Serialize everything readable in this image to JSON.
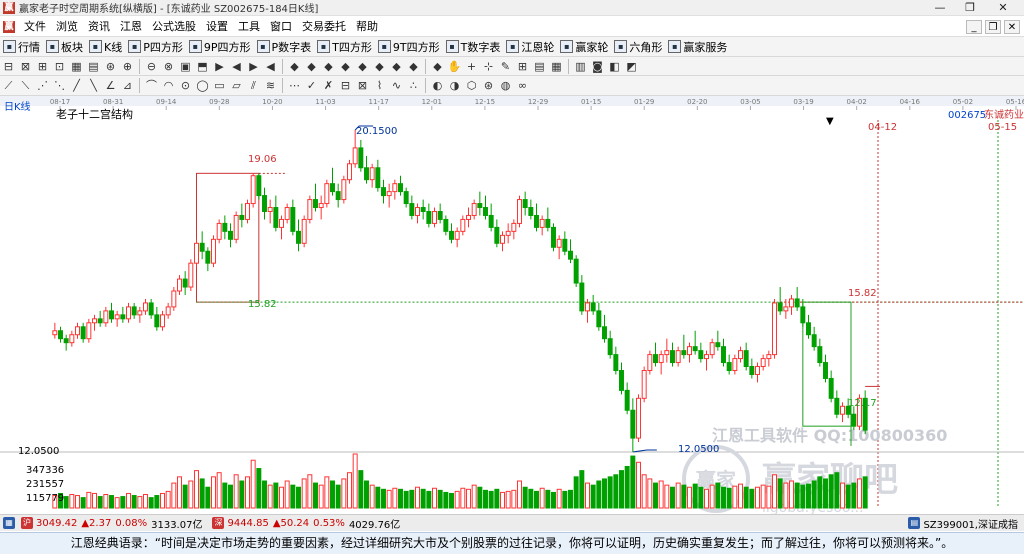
{
  "window": {
    "title": "赢家老子时空周期系统[纵横版] - [东诚药业  SZ002675-184日K线]",
    "min_glyph": "—",
    "restore_glyph": "❐",
    "close_glyph": "✕"
  },
  "menu": {
    "items": [
      "文件",
      "浏览",
      "资讯",
      "江恩",
      "公式选股",
      "设置",
      "工具",
      "窗口",
      "交易委托",
      "帮助"
    ],
    "mdi_min": "_",
    "mdi_restore": "❐",
    "mdi_close": "✕"
  },
  "toolbar1": {
    "buttons": [
      "行情",
      "板块",
      "K线",
      "P四方形",
      "9P四方形",
      "P数字表",
      "T四方形",
      "9T四方形",
      "T数字表",
      "江恩轮",
      "赢家轮",
      "六角形",
      "赢家服务"
    ],
    "icons": [
      "quote-icon",
      "sector-icon",
      "kline-icon",
      "p-square-icon",
      "9p-square-icon",
      "p-table-icon",
      "t-square-icon",
      "9t-square-icon",
      "t-table-icon",
      "gann-wheel-icon",
      "winner-wheel-icon",
      "hexagon-icon",
      "service-icon"
    ]
  },
  "toolbar2": {
    "glyphs": [
      "⊟",
      "⊠",
      "⊞",
      "⊡",
      "▦",
      "▤",
      "⊛",
      "⊕",
      "⊖",
      "⊗",
      "▣",
      "⬒",
      "▶",
      "◀",
      "▶",
      "◀",
      "◆",
      "◆",
      "◆",
      "◆",
      "◆",
      "◆",
      "◆",
      "◆",
      "◆",
      "✋",
      "+",
      "⊹",
      "✎",
      "⊞",
      "▤",
      "▦",
      "▥",
      "◙",
      "◧",
      "◩"
    ]
  },
  "toolbar3": {
    "glyphs": [
      "⟋",
      "⟍",
      "⋰",
      "⋱",
      "╱",
      "╲",
      "∠",
      "⊿",
      "⌒",
      "◠",
      "⊙",
      "◯",
      "▭",
      "▱",
      "⫽",
      "≋",
      "⋯",
      "✓",
      "✗",
      "⊟",
      "⊠",
      "⌇",
      "∿",
      "∴",
      "◐",
      "◑",
      "⬡",
      "⊛",
      "◍",
      "∞"
    ]
  },
  "chart": {
    "period_label": "日K线",
    "study_label": "老子十二宫结构",
    "dropdown_glyph": "▼",
    "code_label": "002675",
    "name_label": "东诚药业",
    "price_levels": {
      "high_label": "20.1500",
      "low_label": "12.0500",
      "level_1906": "19.06",
      "level_1582_left": "15.82",
      "level_1582_right": "15.82",
      "level_right_low": "12.17"
    },
    "right_dates": [
      "04-12",
      "05-15"
    ],
    "volume_ticks": [
      "347336",
      "231557",
      "115779"
    ],
    "price_axis_label": "12.0500",
    "volume_unit_label": "K线",
    "watermark": {
      "line1": "江恩工具软件  QQ:100800360",
      "line2": "赢家聊吧",
      "line3": "ligoba.yesoo...",
      "seal_text": "赢家"
    },
    "colors": {
      "up": "#ff3333",
      "down": "#00a000",
      "grid": "#cfd8e8",
      "box": "#cc3333",
      "green_line": "#20a020",
      "accent_blue": "#0044cc"
    }
  },
  "chart_data": {
    "type": "candlestick",
    "title": "东诚药业 002675 日K线",
    "x_labels": [
      "08-17",
      "08-31",
      "09-14",
      "09-28",
      "10-20",
      "11-03",
      "11-17",
      "12-01",
      "12-15",
      "12-29",
      "01-15",
      "01-29",
      "02-20",
      "03-05",
      "03-19",
      "04-02",
      "04-16",
      "05-02",
      "05-16"
    ],
    "price_range": [
      12.05,
      20.15
    ],
    "annotated_high": 20.15,
    "annotated_low": 12.05,
    "levels": [
      19.06,
      15.82,
      12.17
    ],
    "volume_ticks": [
      115779,
      231557,
      347336
    ],
    "ohlc": [
      [
        15.0,
        15.3,
        14.9,
        15.1
      ],
      [
        15.1,
        15.2,
        14.8,
        14.9
      ],
      [
        14.9,
        15.0,
        14.6,
        14.8
      ],
      [
        14.8,
        15.1,
        14.7,
        15.0
      ],
      [
        15.0,
        15.3,
        14.9,
        15.2
      ],
      [
        15.2,
        15.3,
        14.8,
        14.9
      ],
      [
        14.9,
        15.4,
        14.8,
        15.3
      ],
      [
        15.3,
        15.5,
        15.1,
        15.4
      ],
      [
        15.4,
        15.6,
        15.2,
        15.3
      ],
      [
        15.3,
        15.7,
        15.2,
        15.6
      ],
      [
        15.6,
        15.8,
        15.3,
        15.4
      ],
      [
        15.4,
        15.6,
        15.2,
        15.5
      ],
      [
        15.5,
        15.7,
        15.3,
        15.4
      ],
      [
        15.4,
        15.8,
        15.3,
        15.7
      ],
      [
        15.7,
        15.8,
        15.4,
        15.5
      ],
      [
        15.5,
        15.7,
        15.3,
        15.6
      ],
      [
        15.6,
        15.9,
        15.5,
        15.8
      ],
      [
        15.8,
        15.9,
        15.4,
        15.5
      ],
      [
        15.5,
        15.7,
        15.1,
        15.2
      ],
      [
        15.2,
        15.6,
        15.1,
        15.5
      ],
      [
        15.5,
        15.8,
        15.4,
        15.7
      ],
      [
        15.7,
        16.2,
        15.6,
        16.1
      ],
      [
        16.1,
        16.5,
        16.0,
        16.4
      ],
      [
        16.4,
        16.6,
        16.0,
        16.2
      ],
      [
        16.2,
        16.9,
        16.1,
        16.8
      ],
      [
        16.8,
        17.4,
        16.7,
        17.3
      ],
      [
        17.3,
        17.6,
        16.9,
        17.1
      ],
      [
        17.1,
        17.2,
        16.6,
        16.8
      ],
      [
        16.8,
        17.5,
        16.7,
        17.4
      ],
      [
        17.4,
        17.9,
        17.3,
        17.8
      ],
      [
        17.8,
        18.0,
        17.4,
        17.6
      ],
      [
        17.6,
        17.8,
        17.2,
        17.4
      ],
      [
        17.4,
        18.1,
        17.3,
        18.0
      ],
      [
        18.0,
        18.3,
        17.7,
        17.9
      ],
      [
        17.9,
        18.4,
        17.8,
        18.3
      ],
      [
        18.3,
        19.06,
        18.2,
        19.0
      ],
      [
        19.0,
        19.06,
        18.4,
        18.5
      ],
      [
        18.5,
        18.7,
        17.9,
        18.1
      ],
      [
        18.1,
        18.4,
        17.8,
        18.2
      ],
      [
        18.2,
        18.5,
        17.6,
        17.7
      ],
      [
        17.7,
        18.0,
        17.4,
        17.9
      ],
      [
        17.9,
        18.3,
        17.8,
        18.2
      ],
      [
        18.2,
        18.4,
        17.5,
        17.6
      ],
      [
        17.6,
        17.9,
        17.1,
        17.3
      ],
      [
        17.3,
        18.0,
        17.2,
        17.9
      ],
      [
        17.9,
        18.5,
        17.8,
        18.4
      ],
      [
        18.4,
        18.8,
        18.1,
        18.2
      ],
      [
        18.2,
        18.5,
        17.9,
        18.3
      ],
      [
        18.3,
        18.9,
        18.2,
        18.8
      ],
      [
        18.8,
        19.2,
        18.5,
        18.6
      ],
      [
        18.6,
        18.8,
        18.2,
        18.4
      ],
      [
        18.4,
        19.0,
        18.3,
        18.9
      ],
      [
        18.9,
        19.4,
        18.8,
        19.3
      ],
      [
        19.3,
        20.15,
        19.2,
        19.7
      ],
      [
        19.7,
        19.9,
        19.1,
        19.2
      ],
      [
        19.2,
        19.5,
        18.8,
        18.9
      ],
      [
        18.9,
        19.3,
        18.7,
        19.2
      ],
      [
        19.2,
        19.4,
        18.6,
        18.7
      ],
      [
        18.7,
        18.9,
        18.3,
        18.5
      ],
      [
        18.5,
        18.8,
        18.2,
        18.6
      ],
      [
        18.6,
        18.9,
        18.4,
        18.8
      ],
      [
        18.8,
        19.0,
        18.5,
        18.6
      ],
      [
        18.6,
        18.7,
        18.2,
        18.3
      ],
      [
        18.3,
        18.5,
        17.9,
        18.0
      ],
      [
        18.0,
        18.3,
        17.8,
        18.2
      ],
      [
        18.2,
        18.4,
        17.9,
        18.1
      ],
      [
        18.1,
        18.3,
        17.7,
        17.8
      ],
      [
        17.8,
        18.2,
        17.7,
        18.1
      ],
      [
        18.1,
        18.3,
        17.8,
        17.9
      ],
      [
        17.9,
        18.0,
        17.5,
        17.6
      ],
      [
        17.6,
        17.8,
        17.3,
        17.4
      ],
      [
        17.4,
        17.7,
        17.2,
        17.6
      ],
      [
        17.6,
        18.0,
        17.5,
        17.9
      ],
      [
        17.9,
        18.2,
        17.7,
        18.0
      ],
      [
        18.0,
        18.4,
        17.9,
        18.3
      ],
      [
        18.3,
        18.6,
        18.0,
        18.2
      ],
      [
        18.2,
        18.5,
        17.9,
        18.0
      ],
      [
        18.0,
        18.3,
        17.6,
        17.7
      ],
      [
        17.7,
        17.9,
        17.2,
        17.3
      ],
      [
        17.3,
        17.6,
        17.1,
        17.5
      ],
      [
        17.5,
        17.8,
        17.3,
        17.6
      ],
      [
        17.6,
        17.9,
        17.4,
        17.8
      ],
      [
        17.8,
        18.5,
        17.7,
        18.4
      ],
      [
        18.4,
        18.6,
        18.0,
        18.2
      ],
      [
        18.2,
        18.4,
        17.9,
        18.0
      ],
      [
        18.0,
        18.3,
        17.6,
        17.7
      ],
      [
        17.7,
        18.0,
        17.5,
        17.9
      ],
      [
        17.9,
        18.2,
        17.6,
        17.7
      ],
      [
        17.7,
        17.8,
        17.1,
        17.2
      ],
      [
        17.2,
        17.5,
        16.9,
        17.4
      ],
      [
        17.4,
        17.6,
        17.0,
        17.1
      ],
      [
        17.1,
        17.4,
        16.8,
        16.9
      ],
      [
        16.9,
        17.0,
        16.2,
        16.3
      ],
      [
        16.3,
        16.5,
        15.5,
        15.6
      ],
      [
        15.6,
        15.9,
        15.3,
        15.8
      ],
      [
        15.8,
        16.0,
        15.5,
        15.6
      ],
      [
        15.6,
        15.8,
        15.1,
        15.2
      ],
      [
        15.2,
        15.5,
        14.8,
        14.9
      ],
      [
        14.9,
        15.1,
        14.4,
        14.5
      ],
      [
        14.5,
        14.7,
        14.0,
        14.1
      ],
      [
        14.1,
        14.3,
        13.5,
        13.6
      ],
      [
        13.6,
        13.8,
        13.0,
        13.1
      ],
      [
        13.1,
        13.4,
        12.05,
        12.4
      ],
      [
        12.4,
        13.5,
        12.3,
        13.4
      ],
      [
        13.4,
        14.2,
        13.3,
        14.1
      ],
      [
        14.1,
        14.6,
        14.0,
        14.5
      ],
      [
        14.5,
        14.8,
        14.2,
        14.3
      ],
      [
        14.3,
        14.6,
        14.0,
        14.5
      ],
      [
        14.5,
        14.9,
        14.3,
        14.6
      ],
      [
        14.6,
        14.8,
        14.2,
        14.3
      ],
      [
        14.3,
        14.7,
        14.2,
        14.6
      ],
      [
        14.6,
        15.0,
        14.4,
        14.5
      ],
      [
        14.5,
        14.8,
        14.3,
        14.7
      ],
      [
        14.7,
        15.1,
        14.5,
        14.6
      ],
      [
        14.6,
        14.8,
        14.3,
        14.4
      ],
      [
        14.4,
        14.6,
        14.1,
        14.5
      ],
      [
        14.5,
        14.9,
        14.4,
        14.8
      ],
      [
        14.8,
        15.1,
        14.6,
        14.7
      ],
      [
        14.7,
        14.9,
        14.2,
        14.3
      ],
      [
        14.3,
        14.5,
        14.0,
        14.1
      ],
      [
        14.1,
        14.5,
        14.0,
        14.4
      ],
      [
        14.4,
        14.7,
        14.3,
        14.6
      ],
      [
        14.6,
        14.8,
        14.1,
        14.2
      ],
      [
        14.2,
        14.4,
        13.9,
        14.0
      ],
      [
        14.0,
        14.3,
        13.8,
        14.2
      ],
      [
        14.2,
        14.5,
        14.1,
        14.4
      ],
      [
        14.4,
        14.6,
        14.2,
        14.5
      ],
      [
        14.5,
        15.9,
        14.4,
        15.8
      ],
      [
        15.8,
        16.2,
        15.5,
        15.6
      ],
      [
        15.6,
        15.9,
        15.4,
        15.7
      ],
      [
        15.7,
        16.0,
        15.5,
        15.9
      ],
      [
        15.9,
        16.2,
        15.6,
        15.7
      ],
      [
        15.7,
        15.9,
        15.2,
        15.3
      ],
      [
        15.3,
        15.5,
        14.9,
        15.0
      ],
      [
        15.0,
        15.2,
        14.6,
        14.7
      ],
      [
        14.7,
        14.9,
        14.2,
        14.3
      ],
      [
        14.3,
        14.5,
        13.8,
        13.9
      ],
      [
        13.9,
        14.1,
        13.3,
        13.4
      ],
      [
        13.4,
        13.6,
        12.9,
        13.0
      ],
      [
        13.0,
        13.3,
        12.8,
        13.2
      ],
      [
        13.2,
        13.4,
        12.9,
        13.0
      ],
      [
        13.0,
        13.2,
        12.6,
        12.7
      ],
      [
        12.7,
        13.5,
        12.6,
        13.4
      ],
      [
        13.4,
        13.6,
        12.5,
        12.6
      ]
    ],
    "volume": [
      60,
      70,
      55,
      65,
      60,
      50,
      75,
      70,
      55,
      65,
      60,
      50,
      55,
      70,
      60,
      55,
      65,
      50,
      60,
      70,
      80,
      120,
      150,
      110,
      130,
      180,
      140,
      100,
      150,
      170,
      120,
      110,
      160,
      130,
      150,
      230,
      190,
      130,
      110,
      120,
      100,
      130,
      110,
      100,
      140,
      160,
      120,
      110,
      150,
      130,
      110,
      140,
      170,
      260,
      180,
      130,
      110,
      100,
      90,
      85,
      95,
      90,
      80,
      85,
      100,
      90,
      80,
      95,
      85,
      75,
      70,
      80,
      95,
      90,
      110,
      100,
      85,
      80,
      90,
      75,
      80,
      85,
      130,
      100,
      90,
      80,
      95,
      85,
      75,
      90,
      80,
      85,
      150,
      180,
      120,
      110,
      130,
      140,
      150,
      160,
      180,
      200,
      250,
      220,
      160,
      140,
      120,
      130,
      110,
      100,
      120,
      110,
      100,
      115,
      100,
      90,
      110,
      120,
      100,
      95,
      105,
      115,
      100,
      90,
      100,
      110,
      105,
      160,
      140,
      120,
      130,
      120,
      110,
      115,
      130,
      150,
      140,
      160,
      170,
      120,
      110,
      120,
      140,
      150
    ]
  },
  "status": {
    "sh_index": "3049.42",
    "sh_change": "▲2.37",
    "sh_pct": "0.08%",
    "sh_amount": "3133.07亿",
    "sz_index": "9444.85",
    "sz_change": "▲50.24",
    "sz_pct": "0.53%",
    "sz_amount": "4029.76亿",
    "right_label": "SZ399001,深证成指"
  },
  "quote": {
    "text": "江恩经典语录：“时间是决定市场走势的重要因素，经过详细研究大市及个别股票的过往记录，你将可以证明，历史确实重复发生；而了解过往，你将可以预测将来。”。"
  }
}
